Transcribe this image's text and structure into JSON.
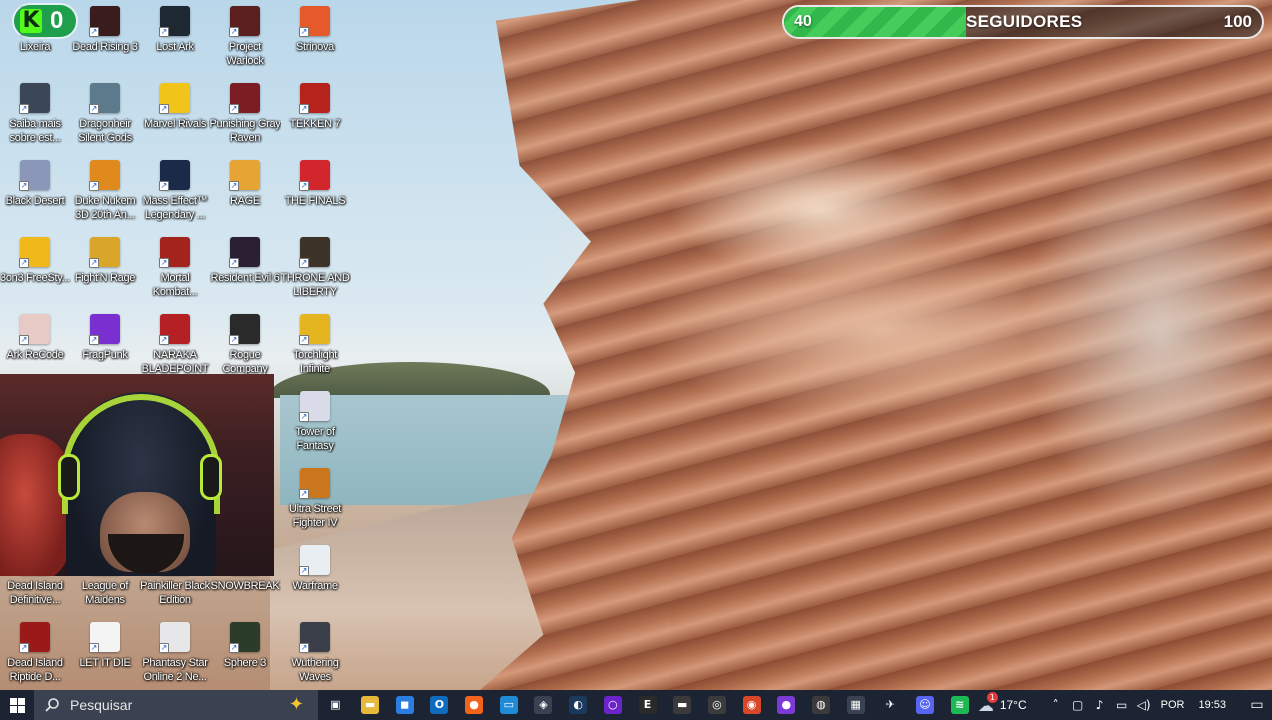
{
  "overlay": {
    "counter_logo": "K",
    "counter_value": "0",
    "goal_start": "40",
    "goal_label": "SEGUIDORES",
    "goal_end": "100",
    "goal_progress_percent": 38
  },
  "desktop": {
    "icons": [
      {
        "label": "Lixeira",
        "color": "#2f3a4a",
        "glyph": "bin-icon"
      },
      {
        "label": "Dead Rising 3",
        "color": "#3a1c1c",
        "glyph": "dead-rising-icon"
      },
      {
        "label": "Lost Ark",
        "color": "#1e2833",
        "glyph": "lost-ark-icon"
      },
      {
        "label": "Project Warlock",
        "color": "#5b1f1f",
        "glyph": "warlock-icon"
      },
      {
        "label": "Strinova",
        "color": "#e55a2b",
        "glyph": "strinova-icon"
      },
      {
        "label": "Saiba mais sobre est...",
        "color": "#3b4756",
        "glyph": "camera-icon"
      },
      {
        "label": "Dragonheir Silent Gods",
        "color": "#5d7a8c",
        "glyph": "dragonheir-icon"
      },
      {
        "label": "Marvel Rivals",
        "color": "#f0c419",
        "glyph": "marvel-rivals-icon"
      },
      {
        "label": "Punishing Gray Raven",
        "color": "#7a1e24",
        "glyph": "pgr-icon"
      },
      {
        "label": "TEKKEN 7",
        "color": "#b5231c",
        "glyph": "tekken-icon"
      },
      {
        "label": "Black Desert",
        "color": "#8a97b8",
        "glyph": "black-desert-icon"
      },
      {
        "label": "Duke Nukem 3D 20th An...",
        "color": "#e08a1e",
        "glyph": "radiation-icon"
      },
      {
        "label": "Mass Effect™ Legendary ...",
        "color": "#1c2a4a",
        "glyph": "mass-effect-icon"
      },
      {
        "label": "RAGE",
        "color": "#e6a435",
        "glyph": "rage-icon"
      },
      {
        "label": "THE FINALS",
        "color": "#d3262c",
        "glyph": "the-finals-icon"
      },
      {
        "label": "3on3 FreeSty...",
        "color": "#f1b81c",
        "glyph": "3on3-icon"
      },
      {
        "label": "Fight'N Rage",
        "color": "#d9a62a",
        "glyph": "fight-n-rage-icon"
      },
      {
        "label": "Mortal Kombat...",
        "color": "#a3241c",
        "glyph": "mortal-kombat-icon"
      },
      {
        "label": "Resident Evil 6",
        "color": "#2b1f33",
        "glyph": "resident-evil-icon"
      },
      {
        "label": "THRONE AND LIBERTY",
        "color": "#3d3328",
        "glyph": "throne-liberty-icon"
      },
      {
        "label": "Ark ReCode",
        "color": "#e7c9c6",
        "glyph": "ark-recode-icon"
      },
      {
        "label": "FragPunk",
        "color": "#7a2fd1",
        "glyph": "fragpunk-icon"
      },
      {
        "label": "NARAKA BLADEPOINT",
        "color": "#b52024",
        "glyph": "naraka-icon"
      },
      {
        "label": "Rogue Company",
        "color": "#2a2a2a",
        "glyph": "rogue-company-icon"
      },
      {
        "label": "Torchlight Infinite",
        "color": "#e4b51f",
        "glyph": "torchlight-icon"
      },
      {
        "label": "Tower of Fantasy",
        "color": "#d9dbe8",
        "glyph": "tower-of-fantasy-icon"
      },
      {
        "label": "Ultra Street Fighter IV",
        "color": "#c9761c",
        "glyph": "street-fighter-icon"
      },
      {
        "label": "Dead Island Definitive...",
        "color": "#55291f",
        "glyph": "dead-island-icon"
      },
      {
        "label": "League of Maidens",
        "color": "#5b2e3f",
        "glyph": "league-maidens-icon"
      },
      {
        "label": "Painkiller Black Edition",
        "color": "#3a2520",
        "glyph": "painkiller-icon"
      },
      {
        "label": "SNOWBREAK",
        "color": "#3d4a5a",
        "glyph": "snowbreak-icon"
      },
      {
        "label": "Warframe",
        "color": "#e9eef2",
        "glyph": "warframe-icon"
      },
      {
        "label": "Dead Island Riptide D...",
        "color": "#9a1a1a",
        "glyph": "dead-island-riptide-icon"
      },
      {
        "label": "LET IT DIE",
        "color": "#f4f4f4",
        "glyph": "let-it-die-icon"
      },
      {
        "label": "Phantasy Star Online 2 Ne...",
        "color": "#e7e7ea",
        "glyph": "pso2-icon"
      },
      {
        "label": "Sphere 3",
        "color": "#2b3d2a",
        "glyph": "sphere-icon"
      },
      {
        "label": "Wuthering Waves",
        "color": "#3b3f4a",
        "glyph": "wuthering-waves-icon"
      }
    ]
  },
  "taskbar": {
    "search_placeholder": "Pesquisar",
    "items": [
      {
        "name": "task-view-icon",
        "glyph": "▣",
        "color": "#1c2433"
      },
      {
        "name": "file-explorer-icon",
        "glyph": "▬",
        "color": "#e7b93a"
      },
      {
        "name": "microsoft-store-icon",
        "glyph": "◼",
        "color": "#2b7de1"
      },
      {
        "name": "outlook-icon",
        "glyph": "O",
        "color": "#0f6cbd"
      },
      {
        "name": "firefox-icon",
        "glyph": "●",
        "color": "#f2641b"
      },
      {
        "name": "remote-desktop-icon",
        "glyph": "▭",
        "color": "#1f8ad6"
      },
      {
        "name": "app-cube-icon",
        "glyph": "◈",
        "color": "#3a4150"
      },
      {
        "name": "steam-icon",
        "glyph": "◐",
        "color": "#1b3a5b"
      },
      {
        "name": "purple-ring-icon",
        "glyph": "○",
        "color": "#6b24c9"
      },
      {
        "name": "epic-games-icon",
        "glyph": "E",
        "color": "#2a2a2a"
      },
      {
        "name": "amazon-games-icon",
        "glyph": "▬",
        "color": "#3a3a3a"
      },
      {
        "name": "obs-icon",
        "glyph": "◎",
        "color": "#3b3b3b"
      },
      {
        "name": "launcher-orange-icon",
        "glyph": "◉",
        "color": "#d9472b"
      },
      {
        "name": "twitch-like-icon",
        "glyph": "●",
        "color": "#7b3ad6"
      },
      {
        "name": "github-icon",
        "glyph": "◍",
        "color": "#3a3a3a"
      },
      {
        "name": "clapper-icon",
        "glyph": "▦",
        "color": "#3a4150"
      },
      {
        "name": "plane-icon",
        "glyph": "✈",
        "color": "#1c2433"
      },
      {
        "name": "discord-icon",
        "glyph": "☺",
        "color": "#5865f2"
      },
      {
        "name": "spotify-icon",
        "glyph": "≋",
        "color": "#1db954"
      }
    ],
    "weather_glyph": "cloud-icon",
    "weather_badge": "1",
    "temperature": "17°C",
    "tray_icons": [
      "chevron-up-icon",
      "device-icon",
      "mic-icon",
      "network-icon",
      "volume-icon"
    ],
    "language": "POR",
    "time": "19:53"
  }
}
